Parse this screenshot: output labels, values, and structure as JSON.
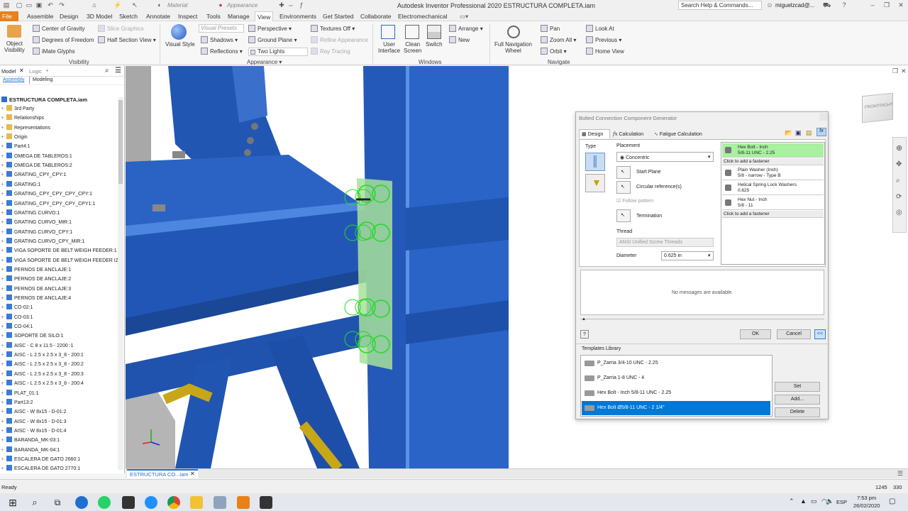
{
  "title_bar": {
    "app_title": "Autodesk Inventor Professional 2020   ESTRUCTURA COMPLETA.iam",
    "search_placeholder": "Search Help & Commands...",
    "user": "miguelzcad@...",
    "material_label": "Material",
    "appearance_label": "Appearance"
  },
  "menu": {
    "items": [
      "File",
      "Assemble",
      "Design",
      "3D Model",
      "Sketch",
      "Annotate",
      "Inspect",
      "Tools",
      "Manage",
      "View",
      "Environments",
      "Get Started",
      "Collaborate",
      "Electromechanical"
    ],
    "active": "View"
  },
  "ribbon": {
    "visibility": {
      "object_visibility": "Object\nVisibility",
      "center_of_gravity": "Center of Gravity",
      "degrees_of_freedom": "Degrees of Freedom",
      "imate_glyphs": "iMate Glyphs",
      "slice_graphics": "Slice Graphics",
      "half_section_view": "Half Section View",
      "panel_title": "Visibility"
    },
    "appearance": {
      "visual_style": "Visual Style",
      "visual_presets": "Visual Presets",
      "perspective": "Perspective",
      "textures_off": "Textures Off",
      "shadows": "Shadows",
      "ground_plane": "Ground Plane",
      "refine_appearance": "Refine Appearance",
      "reflections": "Reflections",
      "two_lights": "Two Lights",
      "ray_tracing": "Ray Tracing",
      "panel_title": "Appearance"
    },
    "windows": {
      "user_interface": "User\nInterface",
      "clean_screen": "Clean\nScreen",
      "switch": "Switch",
      "arrange": "Arrange",
      "new": "New",
      "panel_title": "Windows"
    },
    "navigate": {
      "full_nav_wheel": "Full Navigation\nWheel",
      "pan": "Pan",
      "zoom_all": "Zoom All",
      "orbit": "Orbit",
      "look_at": "Look At",
      "previous": "Previous",
      "home_view": "Home View",
      "panel_title": "Navigate"
    }
  },
  "browser": {
    "tab_model": "Model",
    "tab_logic": "Logic",
    "sub_assembly": "Assembly",
    "sub_modeling": "Modeling",
    "root": "ESTRUCTURA COMPLETA.iam",
    "items": [
      "3rd Party",
      "Relationships",
      "Representations",
      "Origin",
      "Part4:1",
      "OMEGA DE TABLEROS:1",
      "OMEGA DE TABLEROS:2",
      "GRATING_CPY_CPY:1",
      "GRATING:1",
      "GRATING_CPY_CPY_CPY_CPY:1",
      "GRATING_CPY_CPY_CPY_CPY1:1",
      "GRATING CURVO:1",
      "GRATING CURVO_MIR:1",
      "GRATING CURVO_CPY:1",
      "GRATING CURVO_CPY_MIR:1",
      "VIGA SOPORTE DE BELT WEIGH FEEDER:1",
      "VIGA SOPORTE DE BELT WEIGH FEEDER IZ",
      "PERNOS DE ANCLAJE:1",
      "PERNOS DE ANCLAJE:2",
      "PERNOS DE ANCLAJE:3",
      "PERNOS DE ANCLAJE:4",
      "CO-02:1",
      "CO-03:1",
      "CO-04:1",
      "SOPORTE DE SILO:1",
      "AISC - C 8 x 11.5 - 2200 :1",
      "AISC - L 2.5 x 2.5 x 3_8 - 200:1",
      "AISC - L 2.5 x 2.5 x 3_8 - 200:2",
      "AISC - L 2.5 x 2.5 x 3_8 - 200:3",
      "AISC - L 2.5 x 2.5 x 3_8 - 200:4",
      "PLAT_01:1",
      "Part13:2",
      "AISC - W 8x15 - D-01:2",
      "AISC - W 8x15 - D-01:3",
      "AISC - W 8x15 - D-01:4",
      "BARANDA_MK-03:1",
      "BARANDA_MK-04:1",
      "ESCALERA DE GATO 2660:1",
      "ESCALERA DE GATO 2770:1"
    ]
  },
  "viewcube": {
    "front": "FRONT",
    "right": "RIGHT"
  },
  "dialog": {
    "title": "Bolted Connection Component Generator",
    "tab_design": "Design",
    "tab_calculation": "Calculation",
    "tab_fatigue": "Fatigue Calculation",
    "type_label": "Type",
    "placement_label": "Placement",
    "placement_value": "Concentric",
    "start_plane": "Start Plane",
    "circular_refs": "Circular reference(s)",
    "follow_pattern": "Follow pattern",
    "termination": "Termination",
    "thread_label": "Thread",
    "thread_value": "ANSI Unified Screw Threads",
    "diameter_label": "Diameter",
    "diameter_value": "0.625 in",
    "fasteners": [
      {
        "l1": "Hex Bolt - Inch",
        "l2": "5/8-11 UNC - 2.25",
        "selected": true
      },
      {
        "l1": "Click to add a fastener",
        "l2": "",
        "add": true
      },
      {
        "l1": "Plain Washer (Inch)",
        "l2": "5/8 - narrow - Type B"
      },
      {
        "l1": "Helical Spring Lock Washers",
        "l2": "0.625"
      },
      {
        "l1": "Hex Nut - Inch",
        "l2": "5/8 - 11"
      },
      {
        "l1": "Click to add a fastener",
        "l2": "",
        "add": true
      }
    ],
    "messages": "No messages are available.",
    "ok": "OK",
    "cancel": "Cancel",
    "more": "<<",
    "templates_label": "Templates Library",
    "templates": [
      "P_Zarria 3/4-10 UNC - 2.25",
      "P_Zarria 1-8 UNC - 4",
      "Hex Bolt - Inch 5/8-11 UNC - 2.25",
      "Hex Bolt Ø5/8-11 UNC - 2 1/4\""
    ],
    "template_selected": 3,
    "set": "Set",
    "add": "Add...",
    "delete": "Delete"
  },
  "doc_tab": "ESTRUCTURA CO...iam",
  "status": {
    "text": "Ready",
    "x": "1245",
    "y": "330"
  },
  "taskbar": {
    "lang": "ESP",
    "time": "7:53 pm",
    "date": "26/02/2020"
  },
  "colors": {
    "steel_blue": "#2358b8",
    "accent": "#0078d7",
    "bolt_green": "#29d629",
    "file_tab": "#e8811a"
  }
}
